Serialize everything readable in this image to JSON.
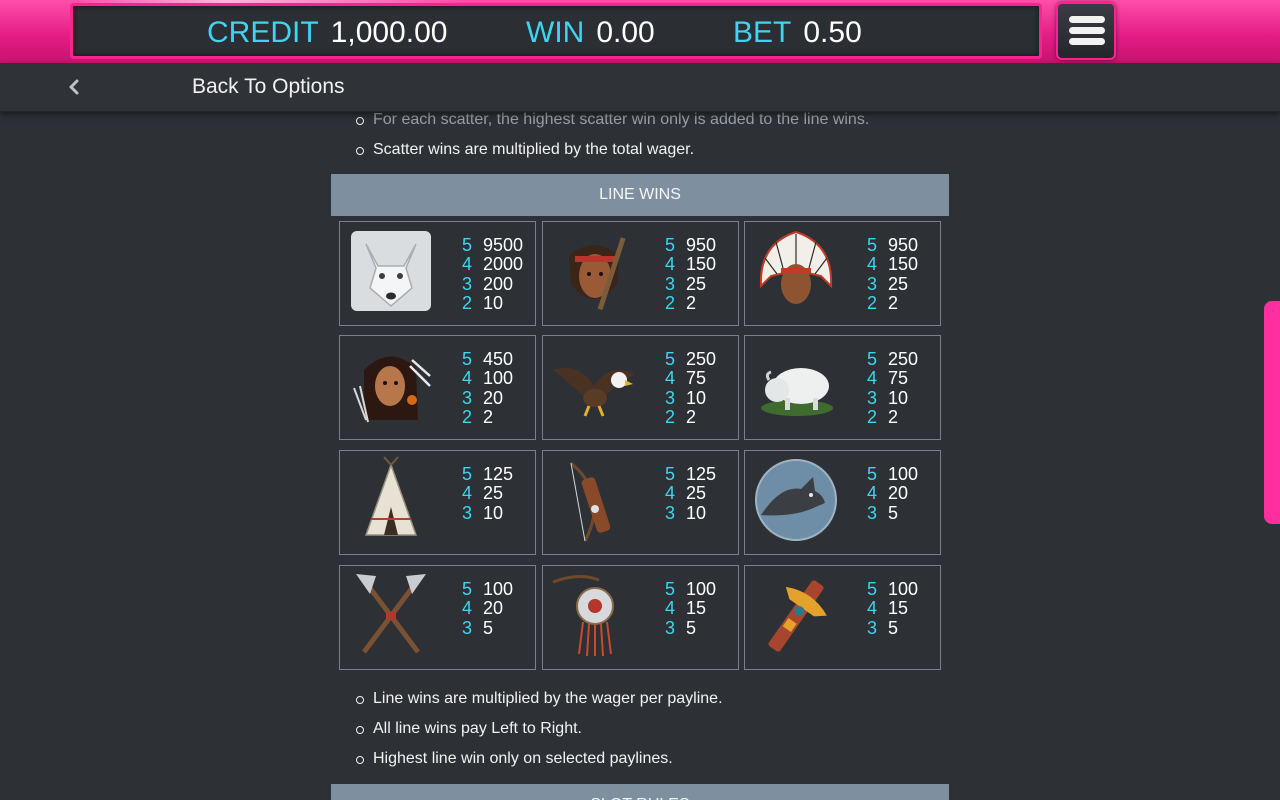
{
  "header": {
    "credit_label": "CREDIT",
    "credit_value": "1,000.00",
    "win_label": "WIN",
    "win_value": "0.00",
    "bet_label": "BET",
    "bet_value": "0.50"
  },
  "nav": {
    "back_label": "Back To Options"
  },
  "rules_top": [
    "For each scatter, the highest scatter win only is added to the line wins.",
    "Scatter wins are multiplied by the total wager."
  ],
  "line_wins": {
    "title": "LINE WINS",
    "symbols": [
      {
        "icon": "white-wolf-icon",
        "pays": [
          {
            "n": "5",
            "v": "9500"
          },
          {
            "n": "4",
            "v": "2000"
          },
          {
            "n": "3",
            "v": "200"
          },
          {
            "n": "2",
            "v": "10"
          }
        ]
      },
      {
        "icon": "warrior-icon",
        "pays": [
          {
            "n": "5",
            "v": "950"
          },
          {
            "n": "4",
            "v": "150"
          },
          {
            "n": "3",
            "v": "25"
          },
          {
            "n": "2",
            "v": "2"
          }
        ]
      },
      {
        "icon": "chief-icon",
        "pays": [
          {
            "n": "5",
            "v": "950"
          },
          {
            "n": "4",
            "v": "150"
          },
          {
            "n": "3",
            "v": "25"
          },
          {
            "n": "2",
            "v": "2"
          }
        ]
      },
      {
        "icon": "woman-icon",
        "pays": [
          {
            "n": "5",
            "v": "450"
          },
          {
            "n": "4",
            "v": "100"
          },
          {
            "n": "3",
            "v": "20"
          },
          {
            "n": "2",
            "v": "2"
          }
        ]
      },
      {
        "icon": "eagle-icon",
        "pays": [
          {
            "n": "5",
            "v": "250"
          },
          {
            "n": "4",
            "v": "75"
          },
          {
            "n": "3",
            "v": "10"
          },
          {
            "n": "2",
            "v": "2"
          }
        ]
      },
      {
        "icon": "white-buffalo-icon",
        "pays": [
          {
            "n": "5",
            "v": "250"
          },
          {
            "n": "4",
            "v": "75"
          },
          {
            "n": "3",
            "v": "10"
          },
          {
            "n": "2",
            "v": "2"
          }
        ]
      },
      {
        "icon": "teepee-icon",
        "pays": [
          {
            "n": "5",
            "v": "125"
          },
          {
            "n": "4",
            "v": "25"
          },
          {
            "n": "3",
            "v": "10"
          }
        ]
      },
      {
        "icon": "bow-quiver-icon",
        "pays": [
          {
            "n": "5",
            "v": "125"
          },
          {
            "n": "4",
            "v": "25"
          },
          {
            "n": "3",
            "v": "10"
          }
        ]
      },
      {
        "icon": "wolf-moon-icon",
        "pays": [
          {
            "n": "5",
            "v": "100"
          },
          {
            "n": "4",
            "v": "20"
          },
          {
            "n": "3",
            "v": "5"
          }
        ]
      },
      {
        "icon": "crossed-tomahawks-icon",
        "pays": [
          {
            "n": "5",
            "v": "100"
          },
          {
            "n": "4",
            "v": "20"
          },
          {
            "n": "3",
            "v": "5"
          }
        ]
      },
      {
        "icon": "dreamcatcher-icon",
        "pays": [
          {
            "n": "5",
            "v": "100"
          },
          {
            "n": "4",
            "v": "15"
          },
          {
            "n": "3",
            "v": "5"
          }
        ]
      },
      {
        "icon": "totem-icon",
        "pays": [
          {
            "n": "5",
            "v": "100"
          },
          {
            "n": "4",
            "v": "15"
          },
          {
            "n": "3",
            "v": "5"
          }
        ]
      }
    ]
  },
  "rules_bottom": [
    "Line wins are multiplied by the wager per payline.",
    "All line wins pay Left to Right.",
    "Highest line win only on selected paylines."
  ],
  "next_section_title": "SLOT RULES",
  "colors": {
    "accent_pink": "#f5258f",
    "accent_cyan": "#3fd4f0",
    "section_header": "#7e8fa0",
    "background": "#2d3136"
  }
}
